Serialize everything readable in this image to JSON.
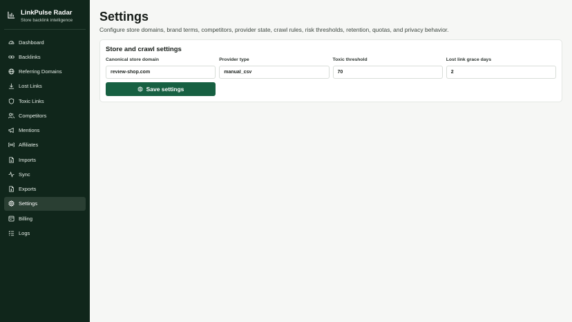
{
  "app": {
    "name": "LinkPulse Radar",
    "tagline": "Store backlink intelligence"
  },
  "sidebar": {
    "items": [
      {
        "label": "Dashboard",
        "icon": "gauge-icon"
      },
      {
        "label": "Backlinks",
        "icon": "link-icon"
      },
      {
        "label": "Referring Domains",
        "icon": "globe-icon"
      },
      {
        "label": "Lost Links",
        "icon": "download-icon"
      },
      {
        "label": "Toxic Links",
        "icon": "shield-icon"
      },
      {
        "label": "Competitors",
        "icon": "users-icon"
      },
      {
        "label": "Mentions",
        "icon": "megaphone-icon"
      },
      {
        "label": "Affiliates",
        "icon": "radio-icon"
      },
      {
        "label": "Imports",
        "icon": "file-import-icon"
      },
      {
        "label": "Sync",
        "icon": "activity-icon"
      },
      {
        "label": "Exports",
        "icon": "file-export-icon"
      },
      {
        "label": "Settings",
        "icon": "gear-icon",
        "active": true
      },
      {
        "label": "Billing",
        "icon": "billing-icon"
      },
      {
        "label": "Logs",
        "icon": "list-icon"
      }
    ]
  },
  "page": {
    "title": "Settings",
    "description": "Configure store domains, brand terms, competitors, provider state, crawl rules, risk thresholds, retention, quotas, and privacy behavior."
  },
  "card": {
    "title": "Store and crawl settings",
    "fields": [
      {
        "label": "Canonical store domain",
        "value": "review-shop.com"
      },
      {
        "label": "Provider type",
        "value": "manual_csv"
      },
      {
        "label": "Toxic threshold",
        "value": "70"
      },
      {
        "label": "Lost link grace days",
        "value": "2"
      }
    ],
    "save_label": "Save settings"
  },
  "colors": {
    "sidebar_bg": "#10261b",
    "sidebar_active": "#2a3f33",
    "accent": "#176042",
    "page_bg": "#f6f7f5"
  }
}
